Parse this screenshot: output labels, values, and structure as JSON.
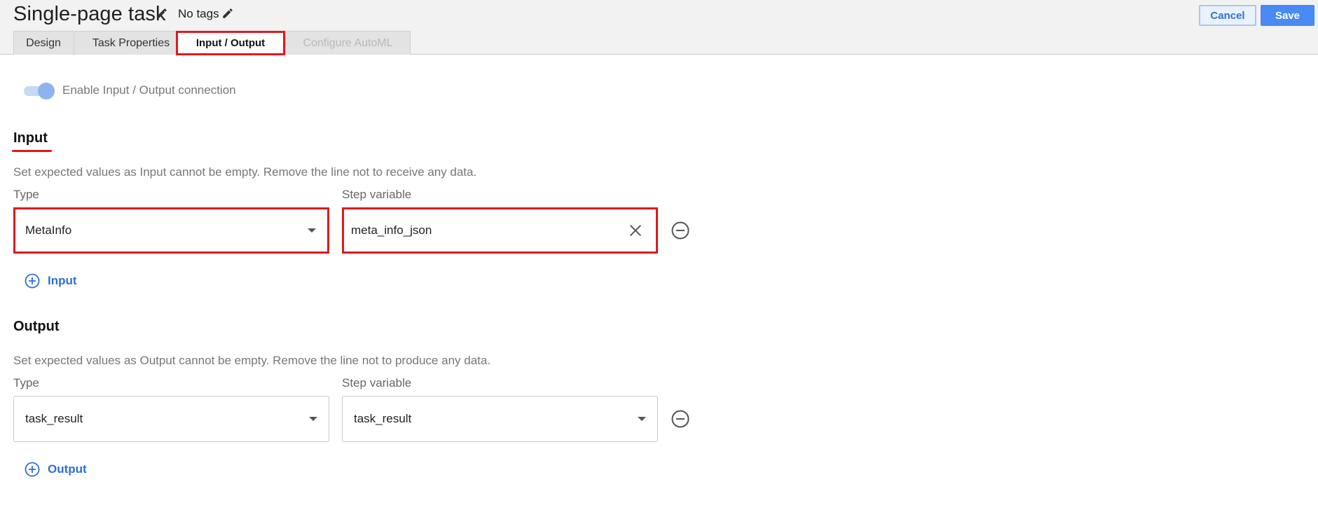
{
  "header": {
    "title": "Single-page task",
    "tags": "No tags",
    "cancel_label": "Cancel",
    "save_label": "Save"
  },
  "tabs": [
    {
      "label": "Design",
      "state": "normal"
    },
    {
      "label": "Task Properties",
      "state": "normal"
    },
    {
      "label": "Input / Output",
      "state": "active"
    },
    {
      "label": "Configure AutoML",
      "state": "disabled"
    }
  ],
  "connection": {
    "label": "Enable Input / Output connection",
    "enabled": true
  },
  "input": {
    "title": "Input",
    "help": "Set expected values as Input cannot be empty. Remove the line not to receive any data.",
    "type_label": "Type",
    "variable_label": "Step variable",
    "row": {
      "type_value": "MetaInfo",
      "variable_value": "meta_info_json"
    },
    "add_label": "Input"
  },
  "output": {
    "title": "Output",
    "help": "Set expected values as Output cannot be empty. Remove the line not to produce any data.",
    "type_label": "Type",
    "variable_label": "Step variable",
    "row": {
      "type_value": "task_result",
      "variable_value": "task_result"
    },
    "add_label": "Output"
  },
  "colors": {
    "accent": "#2e6fd6",
    "save_bg": "#4a8af4",
    "highlight": "#e0191f",
    "toggle_on": "#8eb4ef"
  },
  "icons": {
    "edit": "pencil-icon",
    "remove": "minus-circle-icon",
    "add": "plus-circle-icon",
    "clear": "close-icon",
    "dropdown": "caret-down-icon"
  }
}
